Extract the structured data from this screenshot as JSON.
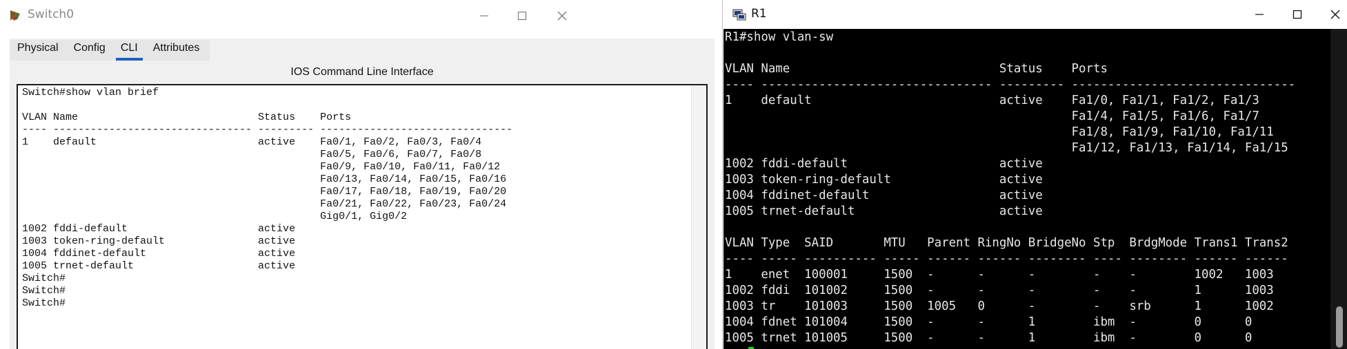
{
  "left_window": {
    "title": "Switch0",
    "tabs": [
      "Physical",
      "Config",
      "CLI",
      "Attributes"
    ],
    "active_tab": "CLI",
    "cli_heading": "IOS Command Line Interface",
    "cli_lines": [
      "Switch#show vlan brief",
      "",
      "VLAN Name                             Status    Ports",
      "---- -------------------------------- --------- -------------------------------",
      "1    default                          active    Fa0/1, Fa0/2, Fa0/3, Fa0/4",
      "                                                Fa0/5, Fa0/6, Fa0/7, Fa0/8",
      "                                                Fa0/9, Fa0/10, Fa0/11, Fa0/12",
      "                                                Fa0/13, Fa0/14, Fa0/15, Fa0/16",
      "                                                Fa0/17, Fa0/18, Fa0/19, Fa0/20",
      "                                                Fa0/21, Fa0/22, Fa0/23, Fa0/24",
      "                                                Gig0/1, Gig0/2",
      "1002 fddi-default                     active",
      "1003 token-ring-default               active",
      "1004 fddinet-default                  active",
      "1005 trnet-default                    active",
      "Switch#",
      "Switch#",
      "Switch#"
    ]
  },
  "right_window": {
    "title": "R1",
    "terminal_lines": [
      "R1#show vlan-sw",
      "",
      "VLAN Name                             Status    Ports",
      "---- -------------------------------- --------- -------------------------------",
      "1    default                          active    Fa1/0, Fa1/1, Fa1/2, Fa1/3",
      "                                                Fa1/4, Fa1/5, Fa1/6, Fa1/7",
      "                                                Fa1/8, Fa1/9, Fa1/10, Fa1/11",
      "                                                Fa1/12, Fa1/13, Fa1/14, Fa1/15",
      "1002 fddi-default                     active",
      "1003 token-ring-default               active",
      "1004 fddinet-default                  active",
      "1005 trnet-default                    active",
      "",
      "VLAN Type  SAID       MTU   Parent RingNo BridgeNo Stp  BrdgMode Trans1 Trans2",
      "---- ----- ---------- ----- ------ ------ -------- ---- -------- ------ ------",
      "1    enet  100001     1500  -      -      -        -    -        1002   1003",
      "1002 fddi  101002     1500  -      -      -        -    -        1      1003",
      "1003 tr    101003     1500  1005   0      -        -    srb      1      1002",
      "1004 fdnet 101004     1500  -      -      1        ibm  -        0      0",
      "1005 trnet 101005     1500  -      -      1        ibm  -        0      0"
    ]
  },
  "colors": {
    "terminal_bg": "#000000",
    "terminal_fg": "#e8e8e8",
    "tab_underline": "#1f5fbf",
    "cursor": "#17d017"
  }
}
